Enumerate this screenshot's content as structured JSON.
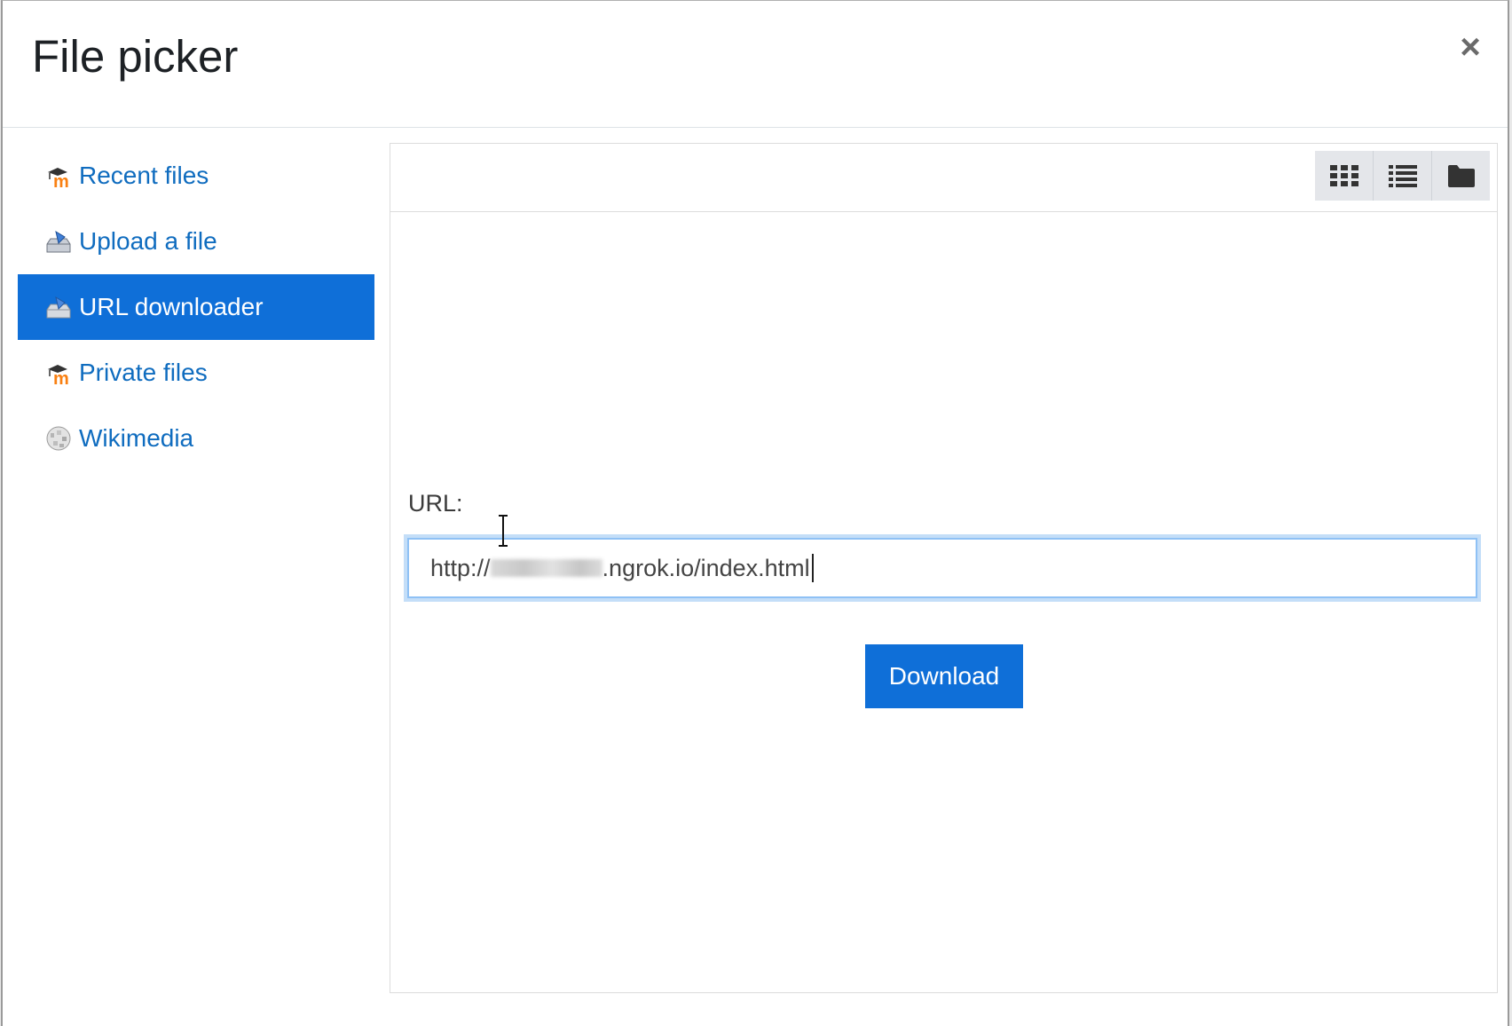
{
  "dialog": {
    "title": "File picker",
    "close_symbol": "×"
  },
  "sidebar": {
    "items": [
      {
        "label": "Recent files",
        "icon": "moodle-icon",
        "active": false
      },
      {
        "label": "Upload a file",
        "icon": "upload-icon",
        "active": false
      },
      {
        "label": "URL downloader",
        "icon": "download-repo-icon",
        "active": true
      },
      {
        "label": "Private files",
        "icon": "moodle-icon",
        "active": false
      },
      {
        "label": "Wikimedia",
        "icon": "wikimedia-globe-icon",
        "active": false
      }
    ]
  },
  "toolbar": {
    "views": [
      "grid-view-icon",
      "list-view-icon",
      "folder-view-icon"
    ]
  },
  "form": {
    "url_label": "URL:",
    "url_prefix": "http://",
    "url_suffix": ".ngrok.io/index.html",
    "download_label": "Download"
  },
  "colors": {
    "accent": "#0f6fd8",
    "link": "#0f6cbf",
    "focus_ring": "#c4def8"
  }
}
